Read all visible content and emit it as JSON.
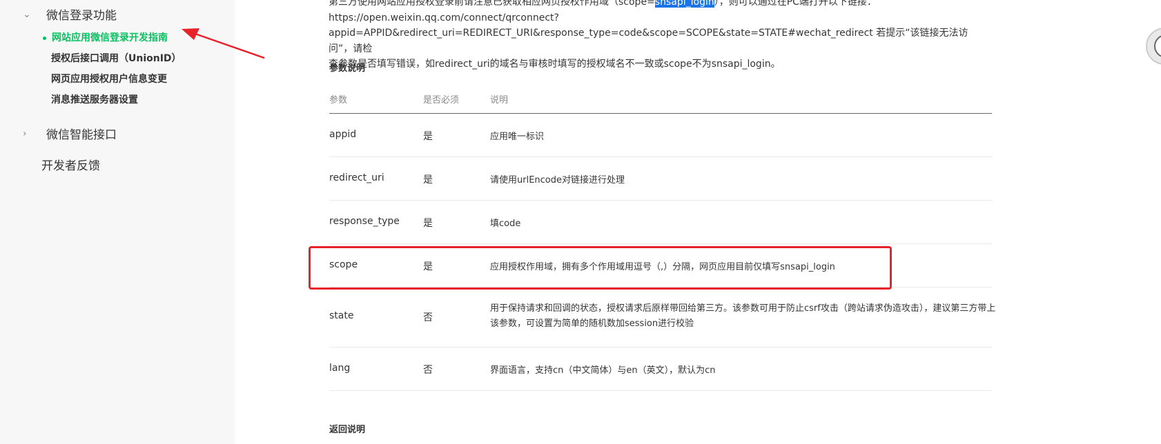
{
  "sidebar": {
    "group_login": "微信登录功能",
    "sub_items": [
      "网站应用微信登录开发指南",
      "授权后接口调用（UnionID）",
      "网页应用授权用户信息变更",
      "消息推送服务器设置"
    ],
    "group_smart": "微信智能接口",
    "feedback": "开发者反馈"
  },
  "intro": {
    "line1_before": "第三方使用网站应用授权登录前请注意已获取相应网页授权作用域（scope=",
    "line1_highlight": "snsapi_login",
    "line1_after": "），则可以通过在PC端打开以下链接：",
    "line2": "https://open.weixin.qq.com/connect/qrconnect?",
    "line3": "appid=APPID&redirect_uri=REDIRECT_URI&response_type=code&scope=SCOPE&state=STATE#wechat_redirect 若提示“该链接无法访问”，请检",
    "line4": "查参数是否填写错误，如redirect_uri的域名与审核时填写的授权域名不一致或scope不为snsapi_login。"
  },
  "params_title": "参数说明",
  "table": {
    "headers": [
      "参数",
      "是否必须",
      "说明"
    ],
    "rows": [
      {
        "name": "appid",
        "required": "是",
        "desc": "应用唯一标识"
      },
      {
        "name": "redirect_uri",
        "required": "是",
        "desc": "请使用urlEncode对链接进行处理"
      },
      {
        "name": "response_type",
        "required": "是",
        "desc": "填code"
      },
      {
        "name": "scope",
        "required": "是",
        "desc": "应用授权作用域，拥有多个作用域用逗号（,）分隔，网页应用目前仅填写snsapi_login"
      },
      {
        "name": "state",
        "required": "否",
        "desc": "用于保持请求和回调的状态，授权请求后原样带回给第三方。该参数可用于防止csrf攻击（跨站请求伪造攻击），建议第三方带上该参数，可设置为简单的随机数加session进行校验"
      },
      {
        "name": "lang",
        "required": "否",
        "desc": "界面语言，支持cn（中文简体）与en（英文），默认为cn"
      }
    ]
  },
  "return_title": "返回说明",
  "float_icon_letter": "C",
  "colors": {
    "accent_green": "#07c160",
    "annotation_red": "#e8222a",
    "highlight_blue": "#1a73e8"
  }
}
